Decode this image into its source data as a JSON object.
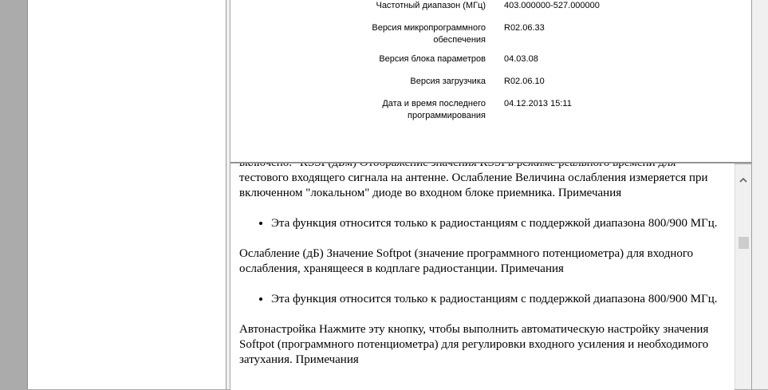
{
  "properties": [
    {
      "label": "Частотный диапазон (МГц)",
      "value": "403.000000-527.000000"
    },
    {
      "label": "Версия микропрограммного обеспечения",
      "value": "R02.06.33"
    },
    {
      "label": "Версия блока параметров",
      "value": "04.03.08"
    },
    {
      "label": "Версия загрузчика",
      "value": "R02.06.10"
    },
    {
      "label": "Дата и время последнего программирования",
      "value": "04.12.2013 15:11"
    }
  ],
  "help": {
    "p1_partial": "включено. \"RSSI (дБм) Отображение значения RSSI в режиме реального времени для",
    "p1": "тестового входящего сигнала на антенне. Ослабление Величина ослабления измеряется при включенном \"локальном\" диоде во входном блоке приемника. Примечания",
    "note1": "Эта функция относится только к радиостанциям с поддержкой диапазона 800/900 МГц.",
    "p2": "Ослабление (дБ) Значение Softpot (значение программного потенциометра) для входного ослабления, хранящееся в кодплаге радиостанции. Примечания",
    "note2": "Эта функция относится только к радиостанциям с поддержкой диапазона 800/900 МГц.",
    "p3": "Автонастройка Нажмите эту кнопку, чтобы выполнить автоматическую настройку значения Softpot (программного потенциометра) для регулировки входного усиления и",
    "p3_partial": "необходимого затухания. Примечания"
  },
  "scrollbar": {
    "up_icon": "chevron-up-icon",
    "position_fraction": 0.12
  },
  "colors": {
    "panel_bg": "#ffffff",
    "chrome_bg": "#f0f0f0",
    "frame_bg": "#ababab"
  }
}
